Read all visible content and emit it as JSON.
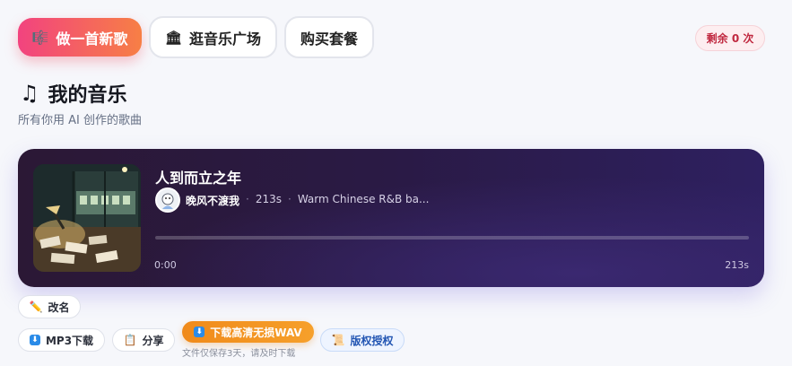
{
  "nav": {
    "create_label": "做一首新歌",
    "plaza_label": "逛音乐广场",
    "buy_label": "购买套餐"
  },
  "quota": {
    "label": "剩余 0 次"
  },
  "page": {
    "title": "我的音乐",
    "subtitle": "所有你用 AI 创作的歌曲"
  },
  "song": {
    "title": "人到而立之年",
    "author": "晚风不渡我",
    "duration": "213s",
    "description": "Warm Chinese R&B ba...",
    "time_start": "0:00",
    "time_end": "213s",
    "progress": 0
  },
  "actions": {
    "rename_label": "改名",
    "mp3_label": "MP3下载",
    "share_label": "分享",
    "wav_label": "下载高清无损WAV",
    "wav_note": "文件仅保存3天，请及时下载",
    "license_label": "版权授权"
  },
  "colors": {
    "brand_gradient_start": "#f2437f",
    "brand_gradient_end": "#f77f45",
    "wav_button": "#f08a1a",
    "license_text": "#2356b3",
    "quota_text": "#c0283f"
  },
  "icons": {
    "create": "music-score-icon",
    "plaza": "building-icon",
    "title": "music-note-icon",
    "rename": "pencil-icon",
    "mp3": "download-icon",
    "share": "clipboard-icon",
    "wav": "download-icon",
    "license": "scroll-icon"
  }
}
